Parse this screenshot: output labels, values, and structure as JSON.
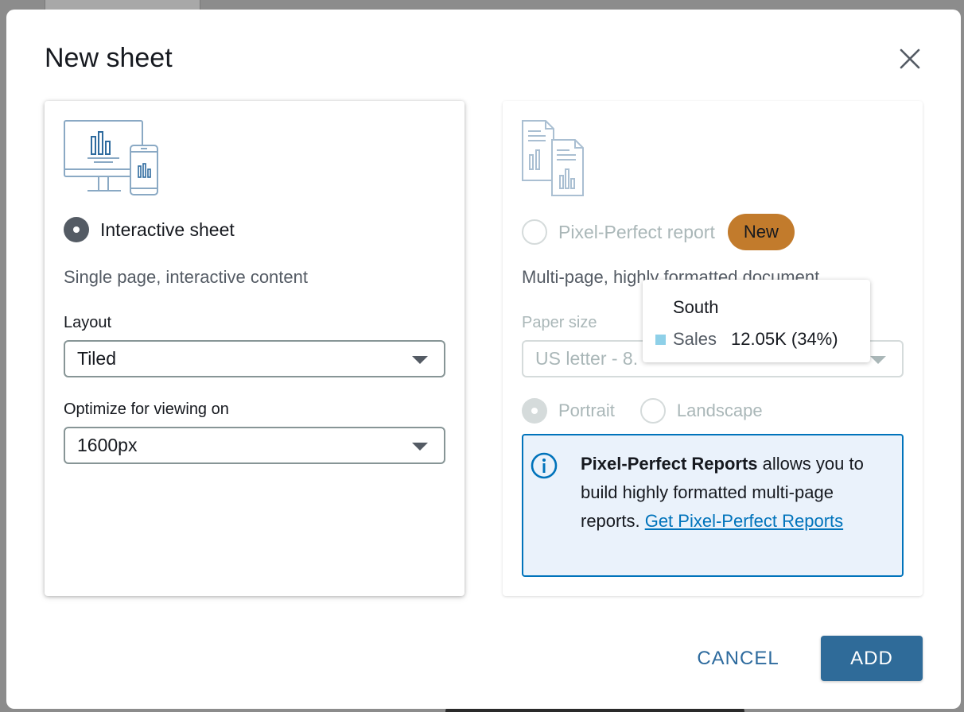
{
  "dialog": {
    "title": "New sheet",
    "close_icon": "close-icon"
  },
  "interactive_card": {
    "icon": "dashboard-devices-icon",
    "option_label": "Interactive sheet",
    "selected": true,
    "description": "Single page, interactive content",
    "layout": {
      "label": "Layout",
      "value": "Tiled"
    },
    "optimize": {
      "label": "Optimize for viewing on",
      "value": "1600px"
    }
  },
  "pixel_card": {
    "icon": "report-documents-icon",
    "option_label": "Pixel-Perfect report",
    "selected": false,
    "badge": "New",
    "description": "Multi-page, highly formatted document",
    "paper_size": {
      "label": "Paper size",
      "value": "US letter - 8."
    },
    "orientation": {
      "portrait": "Portrait",
      "landscape": "Landscape",
      "selected": "Portrait"
    },
    "info": {
      "icon": "info-icon",
      "bold": "Pixel-Perfect Reports",
      "text": " allows you to build highly formatted multi-page reports. ",
      "link": "Get Pixel-Perfect Reports"
    }
  },
  "tooltip": {
    "title": "South",
    "series": "Sales",
    "value": "12.05K (34%)",
    "swatch_color": "#8ed0e8"
  },
  "footer": {
    "cancel_label": "CANCEL",
    "add_label": "ADD"
  },
  "colors": {
    "primary_button": "#2f6b99",
    "badge": "#c27b2c",
    "info_border": "#0073bb",
    "info_bg": "#eaf2fb"
  }
}
